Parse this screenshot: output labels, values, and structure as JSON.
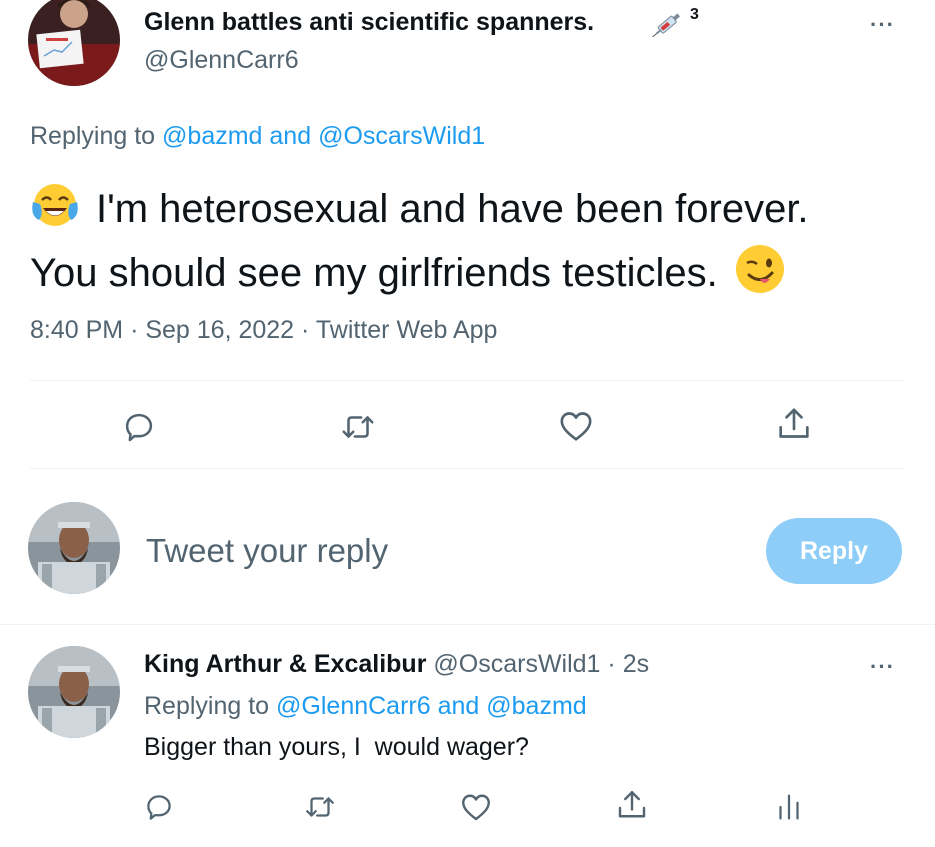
{
  "main_tweet": {
    "display_name": "Glenn battles anti scientific spanners.",
    "badge_count": "3",
    "handle": "@GlennCarr6",
    "replying_prefix": "Replying to",
    "replying_user1": "@bazmd",
    "replying_and": "and",
    "replying_user2": "@OscarsWild1",
    "text_line1": "I'm heterosexual and have been forever.",
    "text_line2": "You should see my girlfriends testicles.",
    "emoji_start": "face-with-tears-of-joy",
    "emoji_end": "winking-face",
    "time": "8:40 PM",
    "sep": "·",
    "date": "Sep 16, 2022",
    "source": "Twitter Web App",
    "more_label": "···"
  },
  "composer": {
    "placeholder": "Tweet your reply",
    "reply_button": "Reply"
  },
  "reply_tweet": {
    "display_name": "King Arthur & Excalibur",
    "handle": "@OscarsWild1",
    "sep": "·",
    "time_ago": "2s",
    "replying_prefix": "Replying to",
    "replying_user1": "@GlennCarr6",
    "replying_and": "and",
    "replying_user2": "@bazmd",
    "text": "Bigger than yours, I  would wager?",
    "more_label": "···"
  },
  "colors": {
    "text": "#0f1419",
    "secondary": "#536471",
    "link": "#1d9bf0",
    "reply_button_disabled": "#8ecdf8",
    "divider": "#eff3f4"
  },
  "icons": [
    "reply-icon",
    "retweet-icon",
    "like-icon",
    "share-icon",
    "analytics-icon",
    "syringe-icon"
  ]
}
